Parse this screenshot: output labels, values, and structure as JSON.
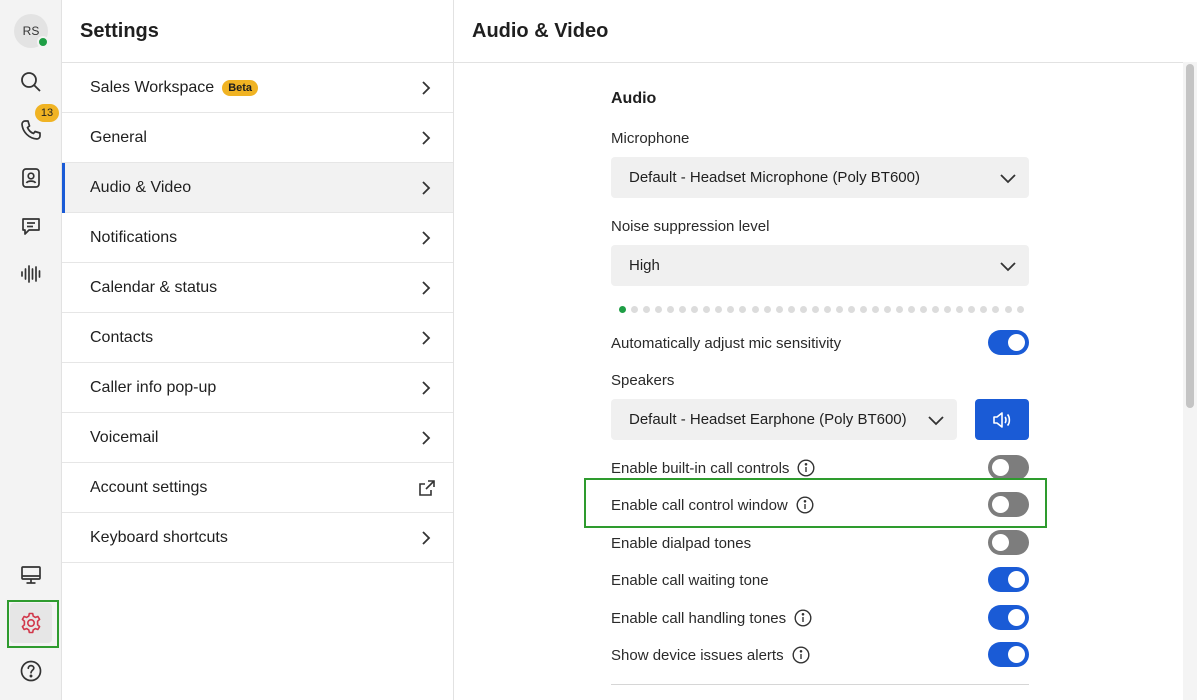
{
  "rail": {
    "avatar_initials": "RS",
    "calls_badge": "13",
    "items": [
      "search-icon",
      "phone-icon",
      "contacts-icon",
      "chat-icon",
      "voicemail-icon",
      "monitor-icon",
      "gear-icon",
      "help-icon"
    ]
  },
  "settings_panel": {
    "title": "Settings",
    "items": [
      {
        "label": "Sales Workspace",
        "badge": "Beta"
      },
      {
        "label": "General"
      },
      {
        "label": "Audio & Video",
        "active": true
      },
      {
        "label": "Notifications"
      },
      {
        "label": "Calendar & status"
      },
      {
        "label": "Contacts"
      },
      {
        "label": "Caller info pop-up"
      },
      {
        "label": "Voicemail"
      },
      {
        "label": "Account settings",
        "icon": "external-link-icon"
      },
      {
        "label": "Keyboard shortcuts"
      }
    ]
  },
  "main": {
    "title": "Audio & Video",
    "section_audio": "Audio",
    "microphone_label": "Microphone",
    "microphone_value": "Default - Headset Microphone (Poly BT600)",
    "noise_label": "Noise suppression level",
    "noise_value": "High",
    "mic_level_fraction": 0.02,
    "speakers_label": "Speakers",
    "speakers_value": "Default - Headset Earphone (Poly BT600)",
    "toggles": [
      {
        "label": "Automatically adjust mic sensitivity",
        "on": true,
        "info": false
      },
      {
        "label": "Enable built-in call controls",
        "on": false,
        "info": true
      },
      {
        "label": "Enable call control window",
        "on": false,
        "info": true
      },
      {
        "label": "Enable dialpad tones",
        "on": false,
        "info": false
      },
      {
        "label": "Enable call waiting tone",
        "on": true,
        "info": false
      },
      {
        "label": "Enable call handling tones",
        "on": true,
        "info": true
      },
      {
        "label": "Show device issues alerts",
        "on": true,
        "info": true
      }
    ]
  },
  "colors": {
    "accent": "#1a5bd6",
    "badge": "#f0b323",
    "highlight": "#2e9b2e",
    "presence": "#1e9e45"
  }
}
